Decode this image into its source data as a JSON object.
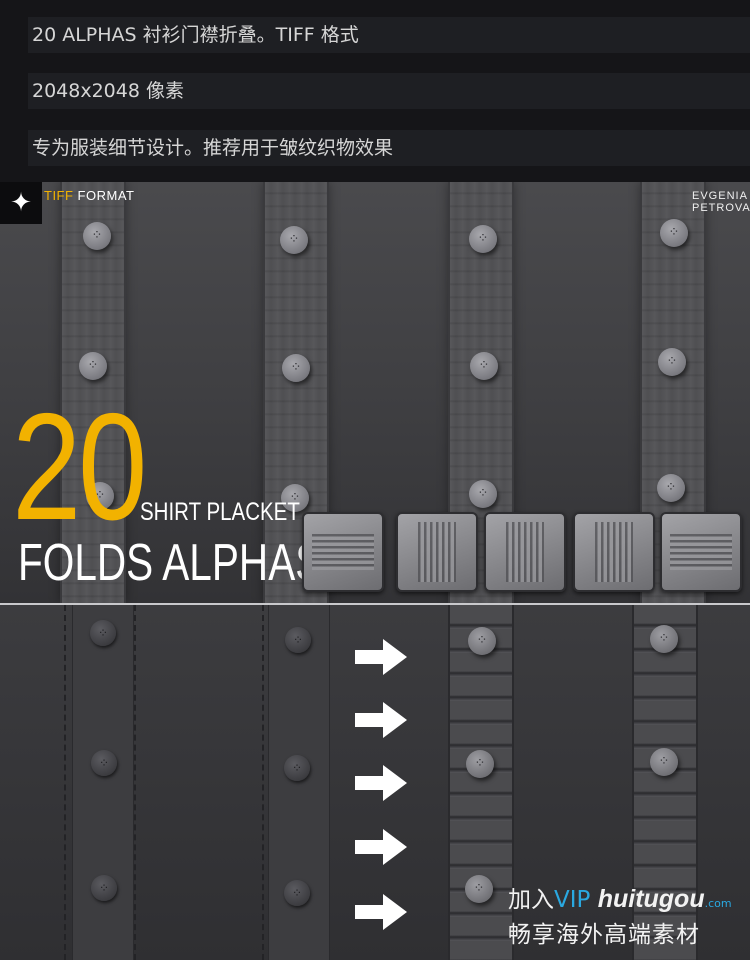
{
  "description": {
    "line1": "20 ALPHAS 衬衫门襟折叠。TIFF 格式",
    "line2": "2048x2048 像素",
    "line3": "专为服装细节设计。推荐用于皱纹织物效果"
  },
  "banner": {
    "format_accent": "TIFF",
    "format_rest": " FORMAT",
    "author_line1": "EVGENIA",
    "author_line2": "PETROVA",
    "count": "20",
    "subtitle": "SHIRT PLACKET",
    "title": "FOLDS ALPHAS",
    "accent_color": "#f2b200"
  },
  "watermark": {
    "prefix": "加入",
    "vip": "VIP",
    "site": "huitugou",
    "domain": ".com",
    "slogan": "畅享海外高端素材"
  },
  "icons": [
    "zbrush-logo-icon",
    "arrow-right-icon",
    "button-icon",
    "alpha-tile-icon"
  ]
}
